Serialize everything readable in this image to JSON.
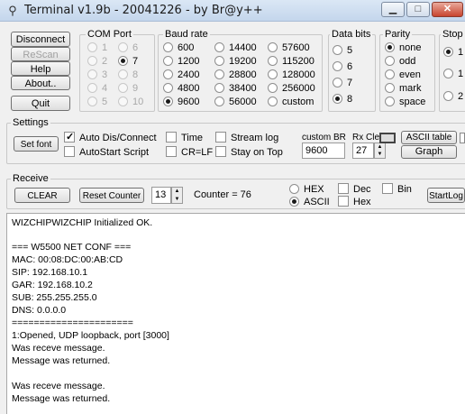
{
  "window": {
    "title": "Terminal v1.9b - 20041226 - by Br@y++",
    "minimize_glyph": "▁",
    "maximize_glyph": "□",
    "close_glyph": "✕"
  },
  "left_buttons": {
    "disconnect": "Disconnect",
    "rescan": "ReScan",
    "help": "Help",
    "about": "About..",
    "quit": "Quit"
  },
  "com_port": {
    "label": "COM Port",
    "options": [
      "1",
      "2",
      "3",
      "4",
      "5",
      "6",
      "7",
      "8",
      "9",
      "10"
    ],
    "selected": "7"
  },
  "baud_rate": {
    "label": "Baud rate",
    "options": [
      "600",
      "1200",
      "2400",
      "4800",
      "9600",
      "14400",
      "19200",
      "28800",
      "38400",
      "56000",
      "57600",
      "115200",
      "128000",
      "256000",
      "custom"
    ],
    "selected": "9600"
  },
  "data_bits": {
    "label": "Data bits",
    "options": [
      "5",
      "6",
      "7",
      "8"
    ],
    "selected": "8"
  },
  "parity": {
    "label": "Parity",
    "options": [
      "none",
      "odd",
      "even",
      "mark",
      "space"
    ],
    "selected": "none"
  },
  "stop_bits": {
    "label": "Stop",
    "options": [
      "1",
      "1",
      "2"
    ]
  },
  "settings": {
    "label": "Settings",
    "set_font": "Set font",
    "auto_dis_connect": "Auto Dis/Connect",
    "autostart_script": "AutoStart Script",
    "time": "Time",
    "cr_lf": "CR=LF",
    "stream_log": "Stream log",
    "stay_on_top": "Stay on Top",
    "custom_br_label": "custom BR",
    "custom_br_value": "9600",
    "rx_clear_label": "Rx Cle",
    "rx_clear_value": "27",
    "ascii_table": "ASCII table",
    "graph": "Graph"
  },
  "receive": {
    "label": "Receive",
    "clear": "CLEAR",
    "reset_counter": "Reset Counter",
    "counter_spin_value": "13",
    "counter_label": "Counter = 76",
    "hex": "HEX",
    "ascii": "ASCII",
    "dec": "Dec",
    "hex_check": "Hex",
    "bin": "Bin",
    "start_log": "StartLog"
  },
  "terminal_lines": [
    "WIZCHIPWIZCHIP Initialized OK.",
    "",
    "=== W5500 NET CONF ===",
    "MAC: 00:08:DC:00:AB:CD",
    "SIP: 192.168.10.1",
    "GAR: 192.168.10.2",
    "SUB: 255.255.255.0",
    "DNS: 0.0.0.0",
    "======================",
    "1:Opened, UDP loopback, port [3000]",
    "Was receve message.",
    "Message was returned.",
    "",
    "Was receve message.",
    "Message was returned."
  ]
}
